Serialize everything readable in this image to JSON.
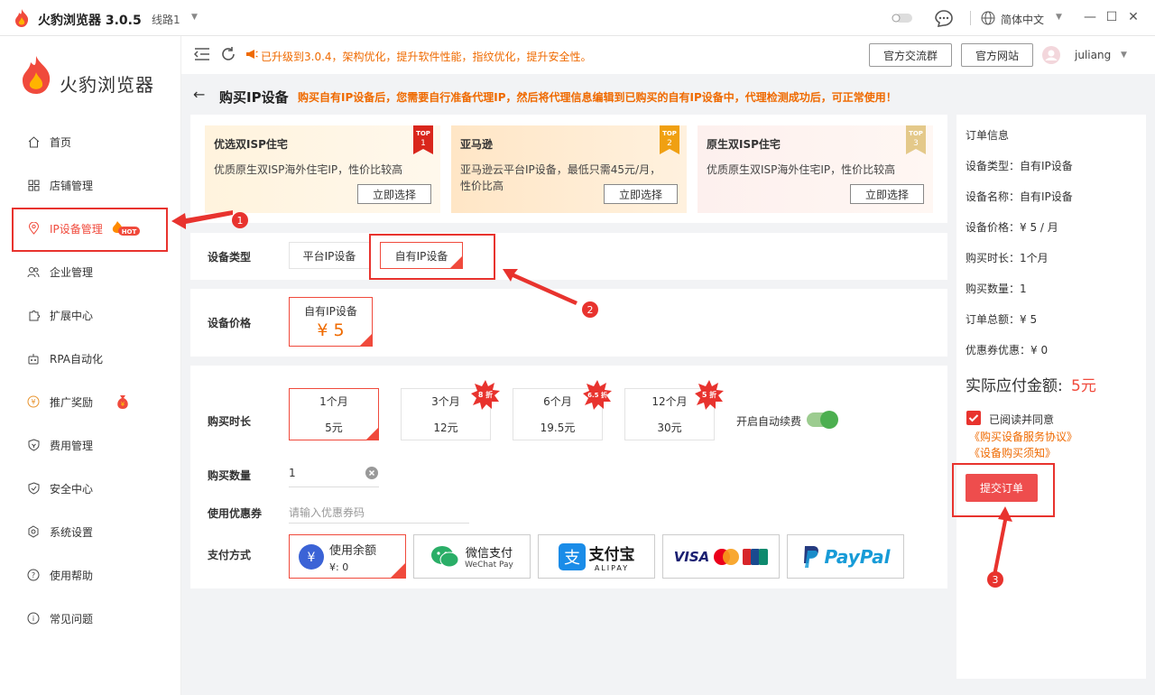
{
  "app": {
    "title": "火豹浏览器 3.0.5",
    "route": "线路1",
    "language": "简体中文"
  },
  "sidebar": {
    "logo_text": "火豹浏览器",
    "items": [
      {
        "label": "首页",
        "icon": "home-icon"
      },
      {
        "label": "店铺管理",
        "icon": "grid-icon"
      },
      {
        "label": "IP设备管理",
        "icon": "location-icon",
        "badge": "HOT"
      },
      {
        "label": "企业管理",
        "icon": "users-icon"
      },
      {
        "label": "扩展中心",
        "icon": "puzzle-icon"
      },
      {
        "label": "RPA自动化",
        "icon": "robot-icon"
      },
      {
        "label": "推广奖励",
        "icon": "gift-icon"
      },
      {
        "label": "费用管理",
        "icon": "shield-icon"
      },
      {
        "label": "安全中心",
        "icon": "shield-check-icon"
      },
      {
        "label": "系统设置",
        "icon": "gear-icon"
      },
      {
        "label": "使用帮助",
        "icon": "help-icon"
      },
      {
        "label": "常见问题",
        "icon": "info-icon"
      }
    ]
  },
  "topbar": {
    "notice": "已升级到3.0.4，架构优化，提升软件性能，指纹优化，提升安全性。",
    "btn_group": "官方交流群",
    "btn_site": "官方网站",
    "username": "juliang"
  },
  "page": {
    "title": "购买IP设备",
    "tip": "购买自有IP设备后，您需要自行准备代理IP，然后将代理信息编辑到已购买的自有IP设备中，代理检测成功后，可正常使用！"
  },
  "cards": [
    {
      "title": "优选双ISP住宅",
      "desc": "优质原生双ISP海外住宅IP，性价比较高",
      "button": "立即选择",
      "rank_top": "TOP",
      "rank_num": "1"
    },
    {
      "title": "亚马逊",
      "desc": "亚马逊云平台IP设备，最低只需45元/月，性价比高",
      "button": "立即选择",
      "rank_top": "TOP",
      "rank_num": "2"
    },
    {
      "title": "原生双ISP住宅",
      "desc": "优质原生双ISP海外住宅IP，性价比较高",
      "button": "立即选择",
      "rank_top": "TOP",
      "rank_num": "3"
    }
  ],
  "form": {
    "device_type_label": "设备类型",
    "device_types": [
      "平台IP设备",
      "自有IP设备"
    ],
    "price_label": "设备价格",
    "price_name": "自有IP设备",
    "price_value": "¥ 5",
    "duration_label": "购买时长",
    "durations": [
      {
        "name": "1个月",
        "price": "5元",
        "discount": ""
      },
      {
        "name": "3个月",
        "price": "12元",
        "discount": "8 折"
      },
      {
        "name": "6个月",
        "price": "19.5元",
        "discount": "6.5 折"
      },
      {
        "name": "12个月",
        "price": "30元",
        "discount": "5 折"
      }
    ],
    "auto_renew_label": "开启自动续费",
    "quantity_label": "购买数量",
    "quantity_value": "1",
    "coupon_label": "使用优惠券",
    "coupon_placeholder": "请输入优惠券码",
    "payment_label": "支付方式",
    "balance_title": "使用余额",
    "balance_value": "¥: 0",
    "wechat_title": "微信支付",
    "wechat_sub": "WeChat Pay",
    "alipay_title": "支付宝",
    "alipay_sub": "ALIPAY",
    "paypal": "PayPal",
    "visa": "VISA"
  },
  "order": {
    "title": "订单信息",
    "device_type": "设备类型：自有IP设备",
    "device_name": "设备名称：自有IP设备",
    "device_price": "设备价格：¥ 5 / 月",
    "duration": "购买时长：1个月",
    "quantity": "购买数量：1",
    "total": "订单总额：¥ 5",
    "discount": "优惠券优惠：¥ 0",
    "payable_label": "实际应付金额:",
    "payable_value": "5元",
    "agree": "已阅读并同意",
    "link1": "《购买设备服务协议》",
    "link2": "《设备购买须知》",
    "submit": "提交订单"
  },
  "annotations": [
    "1",
    "2",
    "3"
  ],
  "colors": {
    "accent": "#f04a3c",
    "orange": "#ef6a00",
    "toggle": "#4caf50"
  }
}
